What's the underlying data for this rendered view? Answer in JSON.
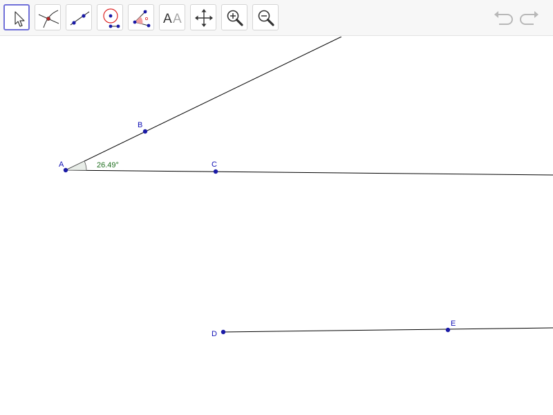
{
  "toolbar": {
    "tools": [
      {
        "name": "Move",
        "icon": "arrow-pointer-icon",
        "selected": true
      },
      {
        "name": "Point on Object / Intersect",
        "icon": "intersect-point-icon",
        "selected": false
      },
      {
        "name": "Line through Two Points",
        "icon": "line-two-points-icon",
        "selected": false
      },
      {
        "name": "Circle with Center",
        "icon": "circle-center-icon",
        "selected": false
      },
      {
        "name": "Angle",
        "icon": "angle-icon",
        "selected": false
      },
      {
        "name": "Text",
        "icon": "text-aa-icon",
        "text": "AA",
        "selected": false
      },
      {
        "name": "Move Graphics View",
        "icon": "move-graphics-icon",
        "selected": false
      },
      {
        "name": "Zoom In",
        "icon": "zoom-in-icon",
        "selected": false
      },
      {
        "name": "Zoom Out",
        "icon": "zoom-out-icon",
        "selected": false
      }
    ],
    "undo": {
      "icon": "undo-icon",
      "enabled": false
    },
    "redo": {
      "icon": "redo-icon",
      "enabled": false
    }
  },
  "construction": {
    "points": [
      {
        "label": "A"
      },
      {
        "label": "B"
      },
      {
        "label": "C"
      },
      {
        "label": "D"
      },
      {
        "label": "E"
      }
    ],
    "lines": [
      {
        "through": [
          "A",
          "B"
        ],
        "kind": "ray"
      },
      {
        "through": [
          "A",
          "C"
        ],
        "kind": "ray"
      },
      {
        "through": [
          "D",
          "E"
        ],
        "kind": "ray"
      }
    ],
    "angle": {
      "vertex": "A",
      "between": [
        "C",
        "B"
      ],
      "value_text": "26.49°"
    }
  },
  "colors": {
    "point": "#1a1aa6",
    "point_label": "#0f0fb4",
    "angle_label": "#1e6e1e",
    "angle_fill": "#e8ede8",
    "line": "#000000",
    "selected_tool_border": "#6f6fd8",
    "disabled_icon": "#b8b8b8"
  }
}
